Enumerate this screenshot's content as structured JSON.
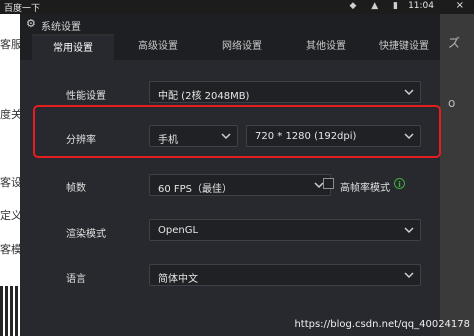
{
  "taskbar": {
    "left_text": "百度一下",
    "time": "11:04"
  },
  "background": {
    "left_fragments": [
      "客服",
      "度关",
      "客设",
      "定义",
      "客模"
    ],
    "right_glyphs": [
      "ズ",
      "o"
    ]
  },
  "dialog": {
    "title": "系统设置",
    "tabs": [
      "常用设置",
      "高级设置",
      "网络设置",
      "其他设置",
      "快捷键设置"
    ],
    "rows": {
      "performance": {
        "label": "性能设置",
        "value": "中配 (2核 2048MB)"
      },
      "resolution": {
        "label": "分辨率",
        "device": "手机",
        "value": "720 * 1280 (192dpi)"
      },
      "fps": {
        "label": "帧数",
        "value": "60 FPS（最佳）",
        "checkbox_label": "高帧率模式",
        "info_icon": "i"
      },
      "render": {
        "label": "渲染模式",
        "value": "OpenGL"
      },
      "language": {
        "label": "语言",
        "value": "简体中文"
      }
    }
  },
  "watermark": "https://blog.csdn.net/qq_40024178",
  "colors": {
    "highlight": "#e21e1e",
    "info": "#3fae3f"
  }
}
